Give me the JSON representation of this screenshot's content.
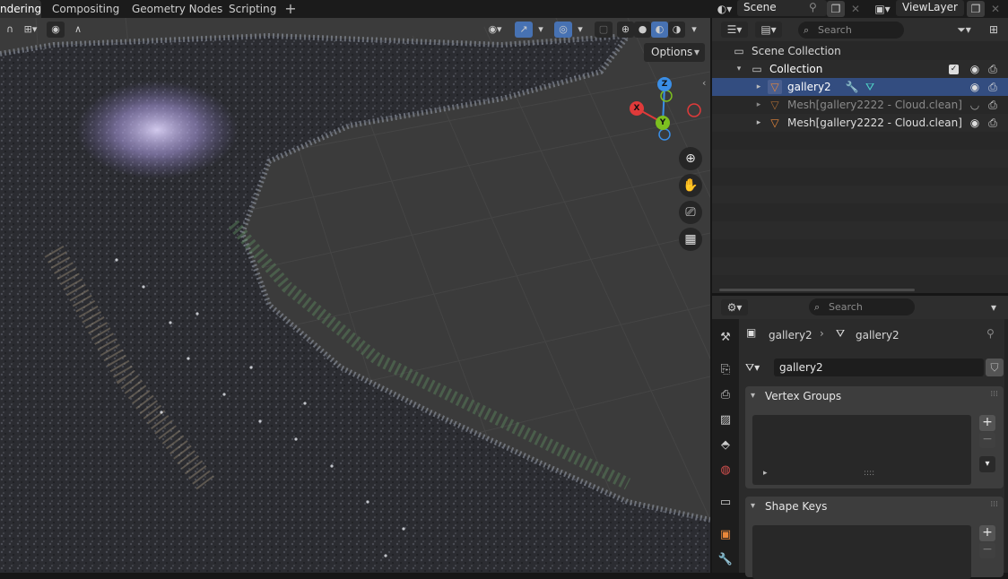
{
  "workspace_tabs": [
    {
      "label": "ndering",
      "active": true
    },
    {
      "label": "Compositing",
      "active": false
    },
    {
      "label": "Geometry Nodes",
      "active": false
    },
    {
      "label": "Scripting",
      "active": false
    }
  ],
  "add_tab": "+",
  "scene": {
    "name": "Scene"
  },
  "view_layer": {
    "name": "ViewLayer"
  },
  "viewport": {
    "options_label": "Options",
    "gizmo": {
      "z": "Z",
      "x": "X",
      "y": "Y"
    },
    "colors": {
      "x": "#e03a3a",
      "y": "#7cbf1f",
      "z": "#3a8ee6",
      "neg_x": "#a32c2c"
    }
  },
  "outliner": {
    "search_placeholder": "Search",
    "scene_collection": "Scene Collection",
    "collection": "Collection",
    "items": [
      {
        "label": "gallery2",
        "selected": true,
        "visible": true
      },
      {
        "label": "Mesh[gallery2222 - Cloud.clean]",
        "selected": false,
        "visible": false
      },
      {
        "label": "Mesh[gallery2222 - Cloud.clean]",
        "selected": false,
        "visible": true
      }
    ]
  },
  "properties": {
    "search_placeholder": "Search",
    "breadcrumb_object": "gallery2",
    "breadcrumb_data": "gallery2",
    "mesh_name": "gallery2",
    "vertex_groups_title": "Vertex Groups",
    "shape_keys_title": "Shape Keys",
    "dots": "::::"
  },
  "accent": "#4772b3"
}
